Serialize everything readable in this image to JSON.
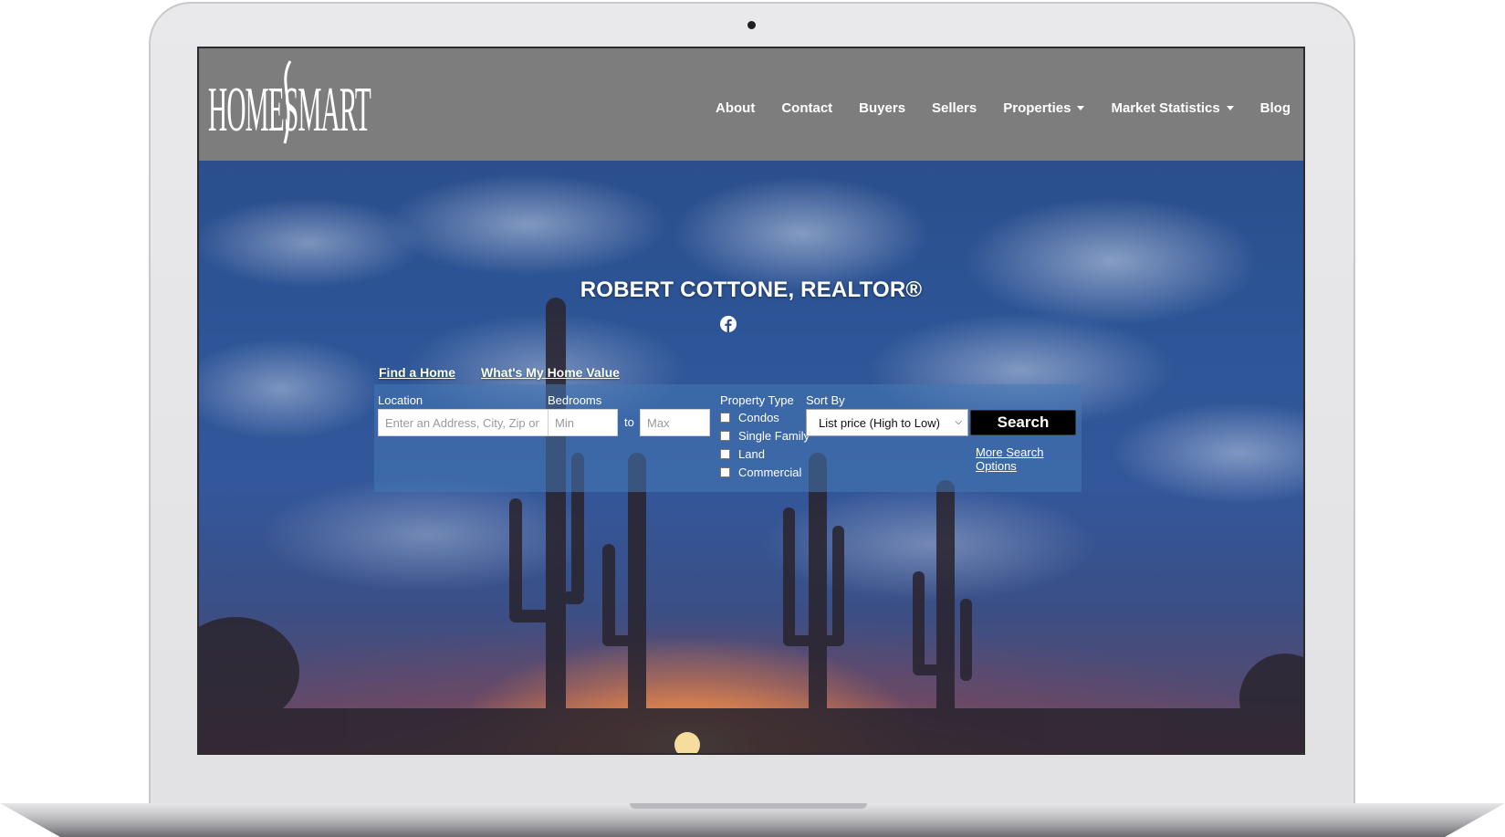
{
  "brand": {
    "logo_text": "HomeSmart"
  },
  "nav": {
    "items": [
      {
        "label": "About",
        "dropdown": false
      },
      {
        "label": "Contact",
        "dropdown": false
      },
      {
        "label": "Buyers",
        "dropdown": false
      },
      {
        "label": "Sellers",
        "dropdown": false
      },
      {
        "label": "Properties",
        "dropdown": true
      },
      {
        "label": "Market Statistics",
        "dropdown": true
      },
      {
        "label": "Blog",
        "dropdown": false
      }
    ]
  },
  "hero": {
    "title": "ROBERT COTTONE, REALTOR®",
    "social_icon": "facebook-icon"
  },
  "search": {
    "tabs": [
      "Find a Home",
      "What's My Home Value"
    ],
    "location": {
      "label": "Location",
      "placeholder": "Enter an Address, City, Zip or MLS#"
    },
    "bedrooms": {
      "label": "Bedrooms",
      "min_placeholder": "Min",
      "to_label": "to",
      "max_placeholder": "Max"
    },
    "property_type": {
      "label": "Property Type",
      "options": [
        "Condos",
        "Single Family",
        "Land",
        "Commercial"
      ]
    },
    "sort_by": {
      "label": "Sort By",
      "selected": "List price (High to Low)"
    },
    "submit_label": "Search",
    "more_options_label": "More Search Options"
  },
  "colors": {
    "header_bg": "#7d7d7d",
    "panel_bg": "rgba(70,120,180,0.55)",
    "button_bg": "#000000",
    "text_light": "#ffffff"
  }
}
